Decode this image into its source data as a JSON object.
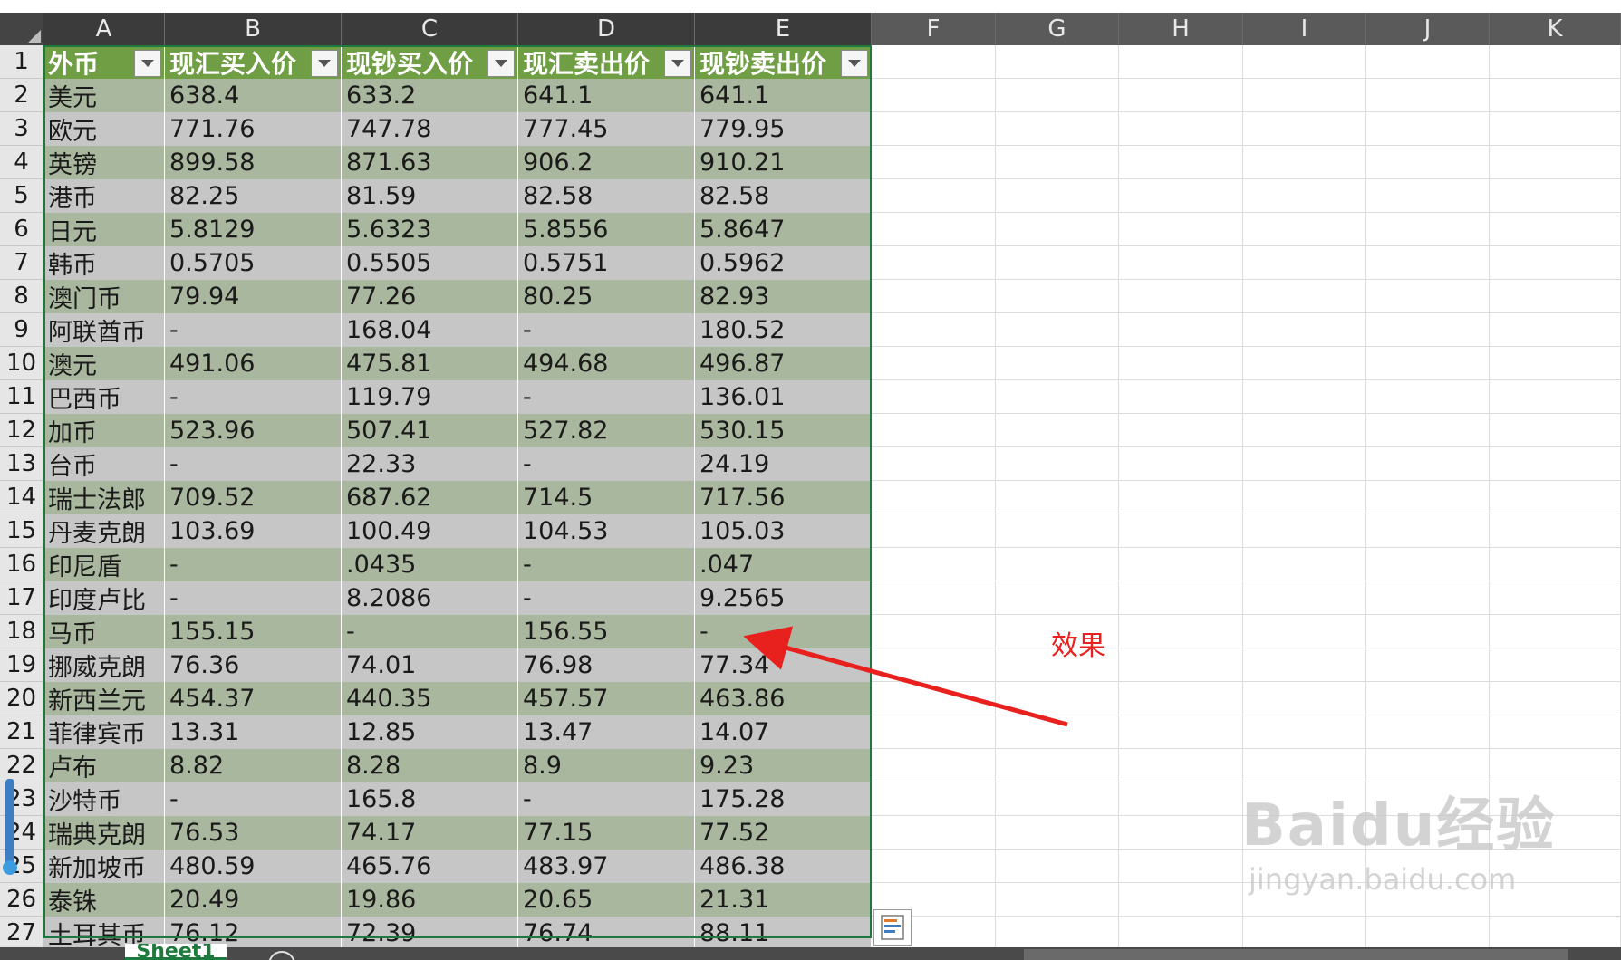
{
  "columns": [
    "A",
    "B",
    "C",
    "D",
    "E",
    "F",
    "G",
    "H",
    "I",
    "J",
    "K"
  ],
  "table": {
    "headers": [
      "外币",
      "现汇买入价",
      "现钞买入价",
      "现汇卖出价",
      "现钞卖出价"
    ],
    "rows": [
      [
        "美元",
        "638.4",
        "633.2",
        "641.1",
        "641.1"
      ],
      [
        "欧元",
        "771.76",
        "747.78",
        "777.45",
        "779.95"
      ],
      [
        "英镑",
        "899.58",
        "871.63",
        "906.2",
        "910.21"
      ],
      [
        "港币",
        "82.25",
        "81.59",
        "82.58",
        "82.58"
      ],
      [
        "日元",
        "5.8129",
        "5.6323",
        "5.8556",
        "5.8647"
      ],
      [
        "韩币",
        "0.5705",
        "0.5505",
        "0.5751",
        "0.5962"
      ],
      [
        "澳门币",
        "79.94",
        "77.26",
        "80.25",
        "82.93"
      ],
      [
        "阿联酋币",
        "-",
        "168.04",
        "-",
        "180.52"
      ],
      [
        "澳元",
        "491.06",
        "475.81",
        "494.68",
        "496.87"
      ],
      [
        "巴西币",
        "-",
        "119.79",
        "-",
        "136.01"
      ],
      [
        "加币",
        "523.96",
        "507.41",
        "527.82",
        "530.15"
      ],
      [
        "台币",
        "-",
        "22.33",
        "-",
        "24.19"
      ],
      [
        "瑞士法郎",
        "709.52",
        "687.62",
        "714.5",
        "717.56"
      ],
      [
        "丹麦克朗",
        "103.69",
        "100.49",
        "104.53",
        "105.03"
      ],
      [
        "印尼盾",
        "-",
        ".0435",
        "-",
        ".047"
      ],
      [
        "印度卢比",
        "-",
        "8.2086",
        "-",
        "9.2565"
      ],
      [
        "马币",
        "155.15",
        "-",
        "156.55",
        "-"
      ],
      [
        "挪威克朗",
        "76.36",
        "74.01",
        "76.98",
        "77.34"
      ],
      [
        "新西兰元",
        "454.37",
        "440.35",
        "457.57",
        "463.86"
      ],
      [
        "菲律宾币",
        "13.31",
        "12.85",
        "13.47",
        "14.07"
      ],
      [
        "卢布",
        "8.82",
        "8.28",
        "8.9",
        "9.23"
      ],
      [
        "沙特币",
        "-",
        "165.8",
        "-",
        "175.28"
      ],
      [
        "瑞典克朗",
        "76.53",
        "74.17",
        "77.15",
        "77.52"
      ],
      [
        "新加坡币",
        "480.59",
        "465.76",
        "483.97",
        "486.38"
      ],
      [
        "泰铢",
        "20.49",
        "19.86",
        "20.65",
        "21.31"
      ],
      [
        "土耳其币",
        "76.12",
        "72.39",
        "76.74",
        "88.11"
      ]
    ]
  },
  "row_numbers": [
    "1",
    "2",
    "3",
    "4",
    "5",
    "6",
    "7",
    "8",
    "9",
    "10",
    "11",
    "12",
    "13",
    "14",
    "15",
    "16",
    "17",
    "18",
    "19",
    "20",
    "21",
    "22",
    "23",
    "24",
    "25",
    "26",
    "27"
  ],
  "annotation": {
    "text": "效果",
    "color": "#e8201e"
  },
  "sheet_tab": {
    "label": "Sheet1"
  },
  "watermark": {
    "logo": "Baidu经验",
    "url": "jingyan.baidu.com"
  },
  "icons": {
    "filter": "dropdown-arrow-icon",
    "quick_analysis": "quick-analysis-icon",
    "add_sheet": "plus-circle-icon"
  },
  "colors": {
    "header_green": "#6f9e45",
    "band_green": "#a9b79e",
    "band_gray": "#c6c6c6",
    "table_border": "#1e7a3c"
  }
}
